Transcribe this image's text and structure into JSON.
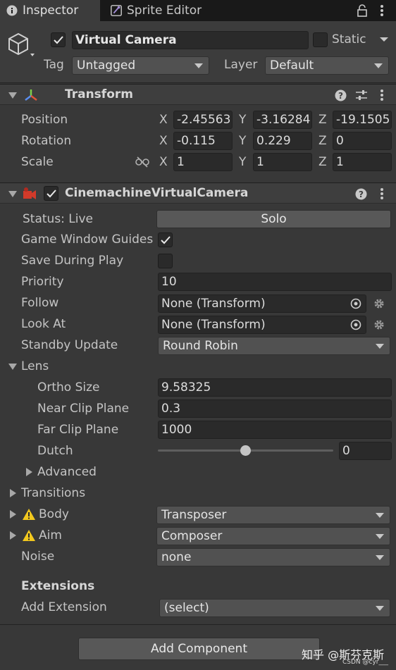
{
  "tabs": [
    {
      "label": "Inspector",
      "icon": "info-icon",
      "active": true
    },
    {
      "label": "Sprite Editor",
      "icon": "sprite-editor-icon",
      "active": false
    }
  ],
  "gameobject": {
    "name": "Virtual Camera",
    "active": true,
    "static_label": "Static",
    "static_checked": false,
    "tag_label": "Tag",
    "tag_value": "Untagged",
    "layer_label": "Layer",
    "layer_value": "Default"
  },
  "transform": {
    "title": "Transform",
    "position_label": "Position",
    "rotation_label": "Rotation",
    "scale_label": "Scale",
    "position": {
      "x": "-2.45563",
      "y": "-3.16284",
      "z": "-19.1505"
    },
    "rotation": {
      "x": "-0.115",
      "y": "0.229",
      "z": "0"
    },
    "scale": {
      "x": "1",
      "y": "1",
      "z": "1"
    },
    "axis_x": "X",
    "axis_y": "Y",
    "axis_z": "Z"
  },
  "vcam": {
    "title": "CinemachineVirtualCamera",
    "enabled": true,
    "status_label": "Status: Live",
    "solo_label": "Solo",
    "guides_label": "Game Window Guides",
    "guides_checked": true,
    "save_label": "Save During Play",
    "save_checked": false,
    "priority_label": "Priority",
    "priority_value": "10",
    "follow_label": "Follow",
    "follow_value": "None (Transform)",
    "lookat_label": "Look At",
    "lookat_value": "None (Transform)",
    "standby_label": "Standby Update",
    "standby_value": "Round Robin",
    "lens_label": "Lens",
    "ortho_label": "Ortho Size",
    "ortho_value": "9.58325",
    "near_label": "Near Clip Plane",
    "near_value": "0.3",
    "far_label": "Far Clip Plane",
    "far_value": "1000",
    "dutch_label": "Dutch",
    "dutch_value": "0",
    "dutch_slider_fraction": 0.5,
    "advanced_label": "Advanced",
    "transitions_label": "Transitions",
    "body_label": "Body",
    "body_value": "Transposer",
    "aim_label": "Aim",
    "aim_value": "Composer",
    "noise_label": "Noise",
    "noise_value": "none",
    "extensions_label": "Extensions",
    "add_extension_label": "Add Extension",
    "add_extension_value": "(select)"
  },
  "add_component_label": "Add Component",
  "watermark": {
    "main": "知乎 @斯芬克斯",
    "sub": "CSDN @cyr___"
  },
  "colors": {
    "background": "#383838",
    "warning": "#f2c81e",
    "vcam_icon": "#d23a2a"
  }
}
